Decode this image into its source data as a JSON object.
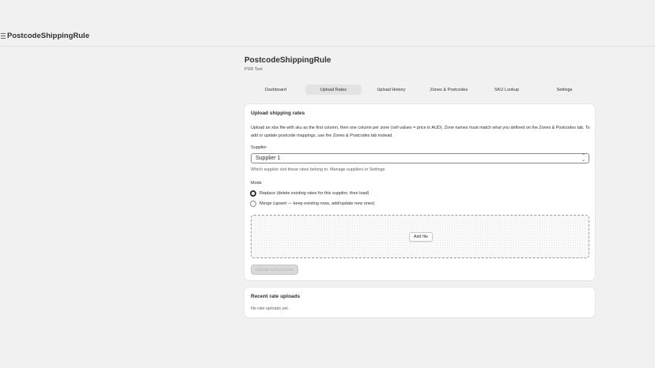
{
  "topbar": {
    "app_title": "PostcodeShippingRule",
    "menu_icon": "hamburger-menu-icon"
  },
  "header": {
    "title": "PostcodeShippingRule",
    "subtitle": "PSR Test"
  },
  "tabs": [
    {
      "label": "Dashboard",
      "active": false
    },
    {
      "label": "Upload Rates",
      "active": true
    },
    {
      "label": "Upload History",
      "active": false
    },
    {
      "label": "Zones & Postcodes",
      "active": false
    },
    {
      "label": "SKU Lookup",
      "active": false
    },
    {
      "label": "Settings",
      "active": false
    }
  ],
  "upload_card": {
    "title": "Upload shipping rates",
    "description": "Upload an xlsx file with sku as the first column, then one column per zone (cell values = price in AUD). Zone names must match what you defined on the Zones & Postcodes tab. To add or update postcode mappings, use the Zones & Postcodes tab instead.",
    "supplier_label": "Supplier",
    "supplier_value": "Supplier 1",
    "supplier_help": "Which supplier slot these rates belong to. Manage suppliers in Settings.",
    "mode_label": "Mode",
    "mode_options": [
      {
        "label": "Replace (delete existing rates for this supplier, then load)",
        "checked": true
      },
      {
        "label": "Merge (upsert — keep existing rows, add/update new ones)",
        "checked": false
      }
    ],
    "add_file_label": "Add file",
    "upload_button_label": "Upload and process"
  },
  "recent_card": {
    "title": "Recent rate uploads",
    "empty_text": "No rate uploads yet."
  }
}
